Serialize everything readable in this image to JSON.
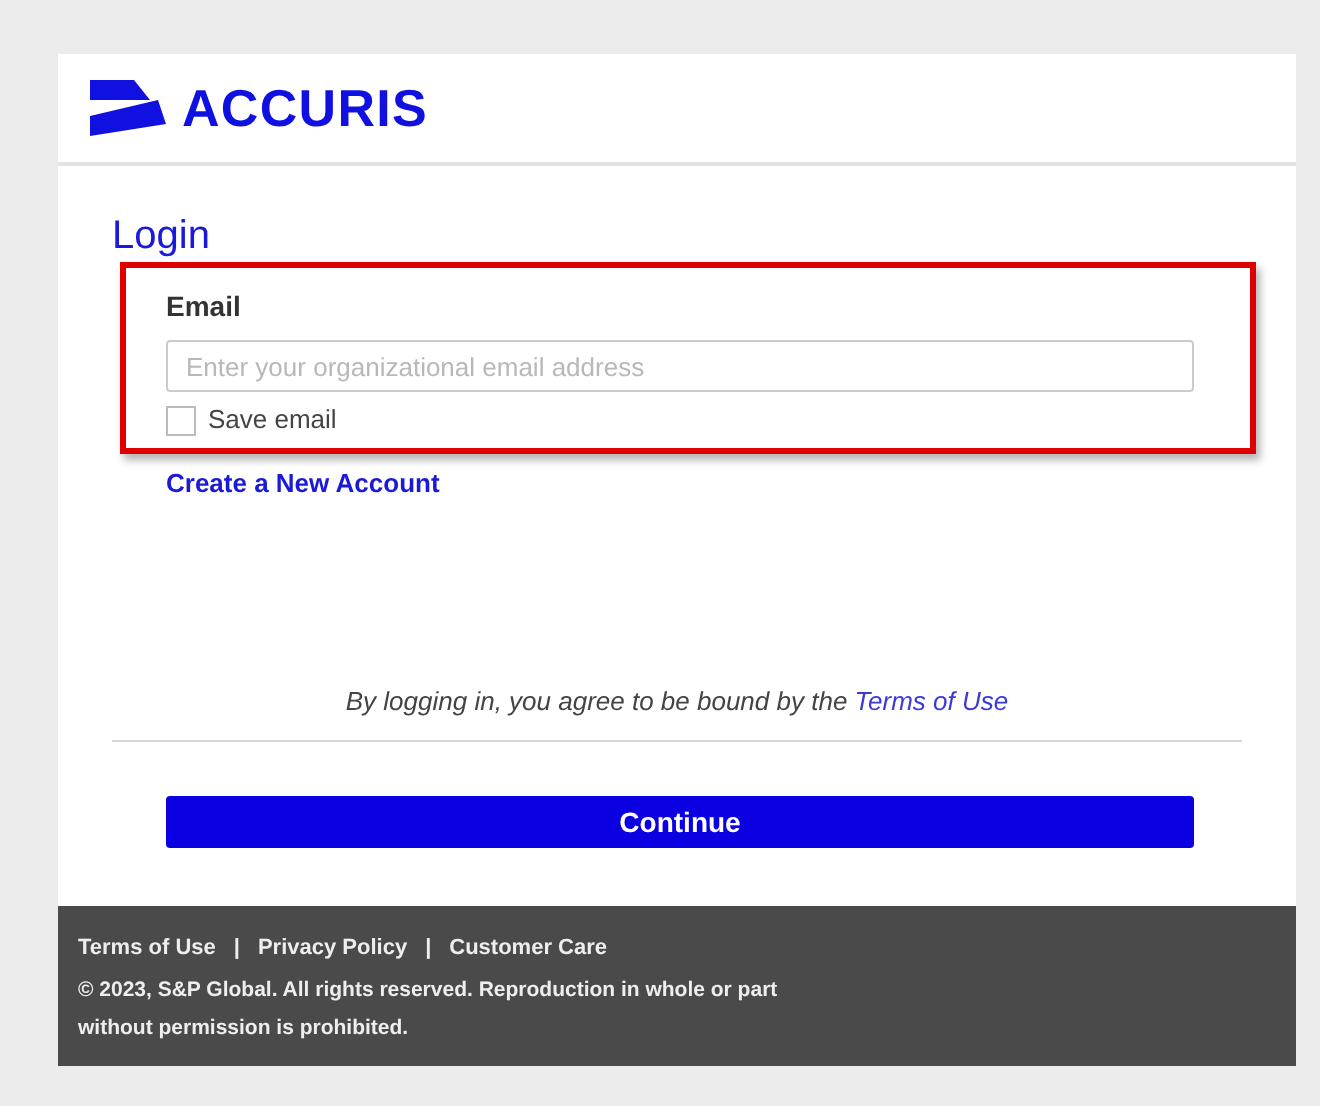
{
  "header": {
    "logo_text": "ACCURIS"
  },
  "login": {
    "title": "Login",
    "email_label": "Email",
    "email_placeholder": "Enter your organizational email address",
    "save_email": {
      "label": "Save email",
      "checked": false
    },
    "create_account": "Create a New Account",
    "agreement": {
      "text": "By logging in, you agree to be bound by the",
      "link": "Terms of Use"
    },
    "continue": "Continue"
  },
  "footer": {
    "links": [
      "Terms of Use",
      "Privacy Policy",
      "Customer Care"
    ],
    "separator": "|",
    "copyright": "© 2023, S&P Global. All rights reserved. Reproduction in whole or part without permission is prohibited."
  }
}
